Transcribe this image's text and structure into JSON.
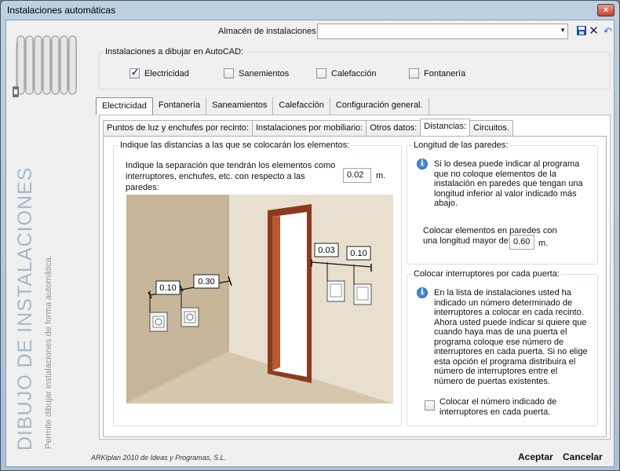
{
  "window": {
    "title": "Instalaciones automáticas",
    "close": "×"
  },
  "header": {
    "store_label": "Almacén de instalaciones",
    "store_value": "",
    "icons": [
      "save-icon",
      "delete-icon",
      "undo-icon"
    ]
  },
  "draw_group": {
    "title": "Instalaciones a dibujar en AutoCAD:",
    "options": [
      {
        "label": "Electricidad",
        "checked": true
      },
      {
        "label": "Sanemientos",
        "checked": false
      },
      {
        "label": "Calefacción",
        "checked": false
      },
      {
        "label": "Fontanería",
        "checked": false
      }
    ]
  },
  "tabs": [
    "Electricidad",
    "Fontanería",
    "Saneamientos",
    "Calefacción",
    "Configuración general."
  ],
  "subtabs": [
    "Puntos de luz y enchufes por recinto:",
    "Instalaciones por mobiliario:",
    "Otros datos:",
    "Distancias:",
    "Circuitos."
  ],
  "distances": {
    "group_title": "Indique las distancias a las que se colocarán los elementos:",
    "separation_text": "Indique la separación que tendrán los elementos como interruptores, enchufes, etc. con respecto a las paredes:",
    "separation_value": "0.02",
    "unit": "m.",
    "illustration_labels": {
      "a": "0.10",
      "b": "0.30",
      "c": "0.03",
      "d": "0.10"
    }
  },
  "wall_length": {
    "title": "Longitud de las paredes:",
    "info": "Si lo desea puede indicar al programa que no coloque elementos de la instalación en paredes que tengan una longitud inferior al valor indicado más abajo.",
    "field_label": "Colocar elementos en paredes con una longitud mayor de:",
    "value": "0.60",
    "unit": "m."
  },
  "per_door": {
    "title": "Colocar interruptores por cada puerta:",
    "info": "En la lista de instalaciones usted ha indicado un número determinado de interruptores a colocar en cada recinto. Ahora usted puede indicar si quiere que cuando haya mas de una puerta el programa coloque ese número de interruptores en cada puerta. Si no elige esta opción el programa distribuira el número de interruptores entre el número de puertas existentes.",
    "checkbox_label": "Colocar el número indicado de interruptores en cada puerta.",
    "checked": false
  },
  "side": {
    "big_title": "DIBUJO DE INSTALACIONES",
    "subtitle": "Permite dibujar instalaciones de forma automática."
  },
  "footer": {
    "copyright": "ARKIplan 2010 de Ideas y Programas, S.L.",
    "accept": "Aceptar",
    "cancel": "Cancelar"
  }
}
